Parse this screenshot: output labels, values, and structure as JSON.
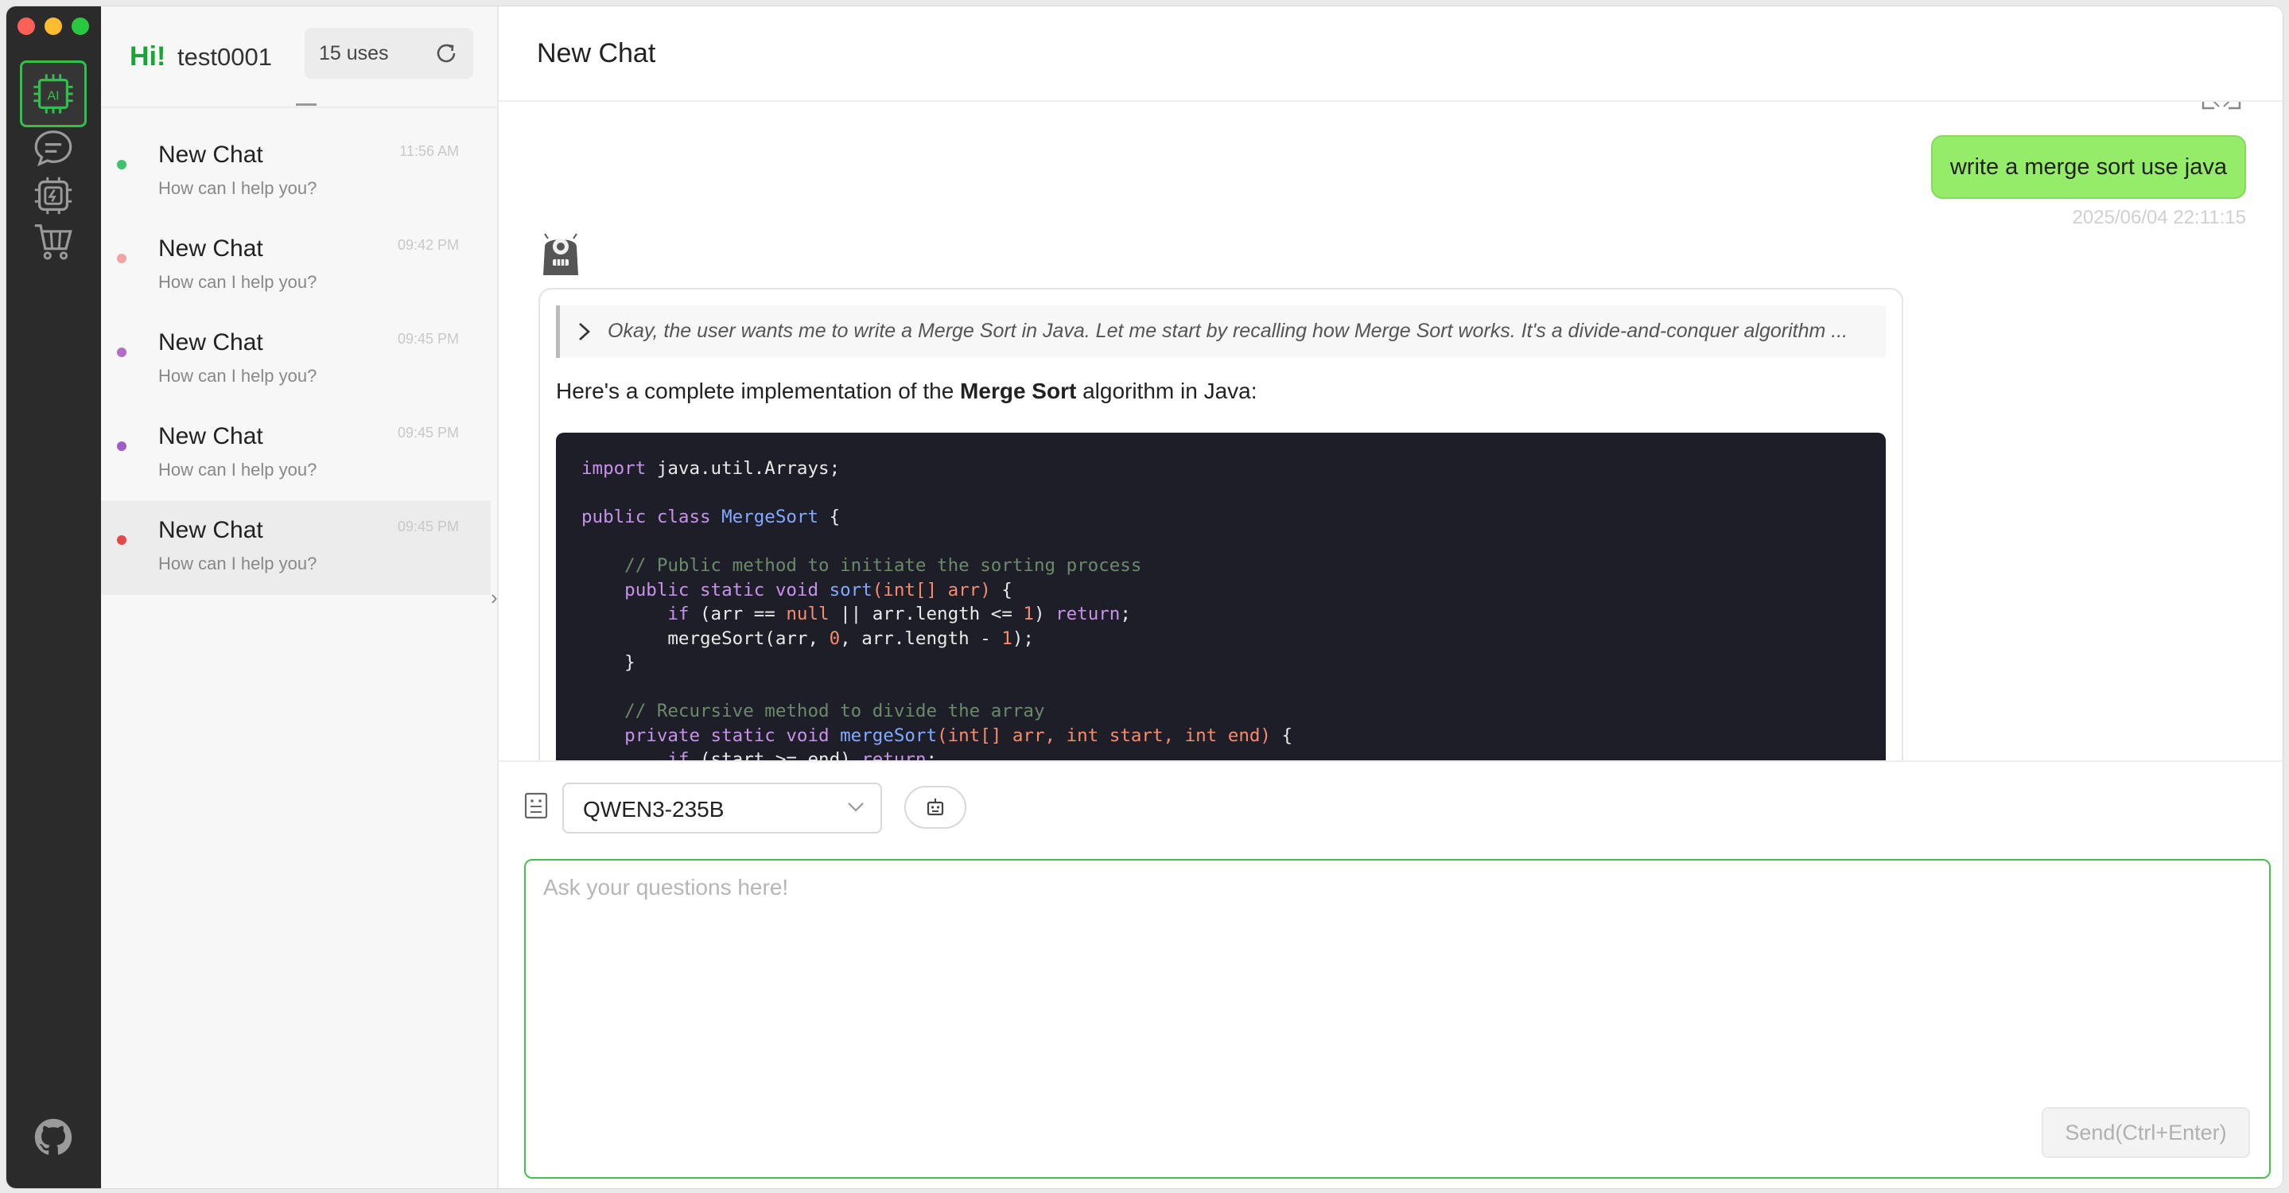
{
  "colors": {
    "accent": "#2fc14a",
    "user_bubble": "#95ec69",
    "rail": "#2b2b2b",
    "code_bg": "#1e1e28"
  },
  "rail": {
    "items": [
      {
        "name": "ai-chat",
        "icon": "ai-chip-icon",
        "active": true
      },
      {
        "name": "messages",
        "icon": "chat-bubble-icon"
      },
      {
        "name": "models",
        "icon": "processor-icon"
      },
      {
        "name": "store",
        "icon": "shopping-cart-icon"
      }
    ],
    "bottom_icon": "github-icon"
  },
  "sidebar": {
    "greeting": "Hi!",
    "username": "test0001",
    "uses_label": "15 uses",
    "chats": [
      {
        "title": "New Chat",
        "subtitle": "How can I help you?",
        "time": "11:56 AM",
        "dot": "#3cc26a"
      },
      {
        "title": "New Chat",
        "subtitle": "How can I help you?",
        "time": "09:42 PM",
        "dot": "#f4a3a3"
      },
      {
        "title": "New Chat",
        "subtitle": "How can I help you?",
        "time": "09:45 PM",
        "dot": "#b36cc9"
      },
      {
        "title": "New Chat",
        "subtitle": "How can I help you?",
        "time": "09:45 PM",
        "dot": "#a25cc7"
      },
      {
        "title": "New Chat",
        "subtitle": "How can I help you?",
        "time": "09:45 PM",
        "dot": "#e54848",
        "selected": true
      }
    ]
  },
  "main": {
    "title": "New Chat",
    "user_message": "write a merge sort use java",
    "user_time": "2025/06/04 22:11:15",
    "thinking": "Okay, the user wants me to write a Merge Sort in Java. Let me start by recalling how Merge Sort works. It's a divide-and-conquer algorithm ...",
    "intro_before": "Here's a complete implementation of the ",
    "intro_bold": "Merge Sort",
    "intro_after": " algorithm in Java:",
    "code_lines": [
      [
        [
          "kw",
          "import"
        ],
        [
          "pl",
          " java.util.Arrays;"
        ]
      ],
      [],
      [
        [
          "kw",
          "public class "
        ],
        [
          "ty",
          "MergeSort"
        ],
        [
          "pl",
          " {"
        ]
      ],
      [],
      [
        [
          "cm",
          "    // Public method to initiate the sorting process"
        ]
      ],
      [
        [
          "kw",
          "    public static void "
        ],
        [
          "fn",
          "sort"
        ],
        [
          "nm",
          "(int[] arr)"
        ],
        [
          "pl",
          " {"
        ]
      ],
      [
        [
          "kw",
          "        if"
        ],
        [
          "pl",
          " (arr == "
        ],
        [
          "nm",
          "null"
        ],
        [
          "pl",
          " || arr.length <= "
        ],
        [
          "nm",
          "1"
        ],
        [
          "pl",
          ") "
        ],
        [
          "kw",
          "return"
        ],
        [
          "pl",
          ";"
        ]
      ],
      [
        [
          "pl",
          "        mergeSort(arr, "
        ],
        [
          "nm",
          "0"
        ],
        [
          "pl",
          ", arr.length - "
        ],
        [
          "nm",
          "1"
        ],
        [
          "pl",
          ");"
        ]
      ],
      [
        [
          "pl",
          "    }"
        ]
      ],
      [],
      [
        [
          "cm",
          "    // Recursive method to divide the array"
        ]
      ],
      [
        [
          "kw",
          "    private static void "
        ],
        [
          "fn",
          "mergeSort"
        ],
        [
          "nm",
          "(int[] arr, int start, int end)"
        ],
        [
          "pl",
          " {"
        ]
      ],
      [
        [
          "kw",
          "        if"
        ],
        [
          "pl",
          " (start >= end) "
        ],
        [
          "kw",
          "return"
        ],
        [
          "pl",
          ";"
        ]
      ]
    ]
  },
  "input": {
    "model": "QWEN3-235B",
    "placeholder": "Ask your questions here!",
    "send_label": "Send(Ctrl+Enter)"
  }
}
